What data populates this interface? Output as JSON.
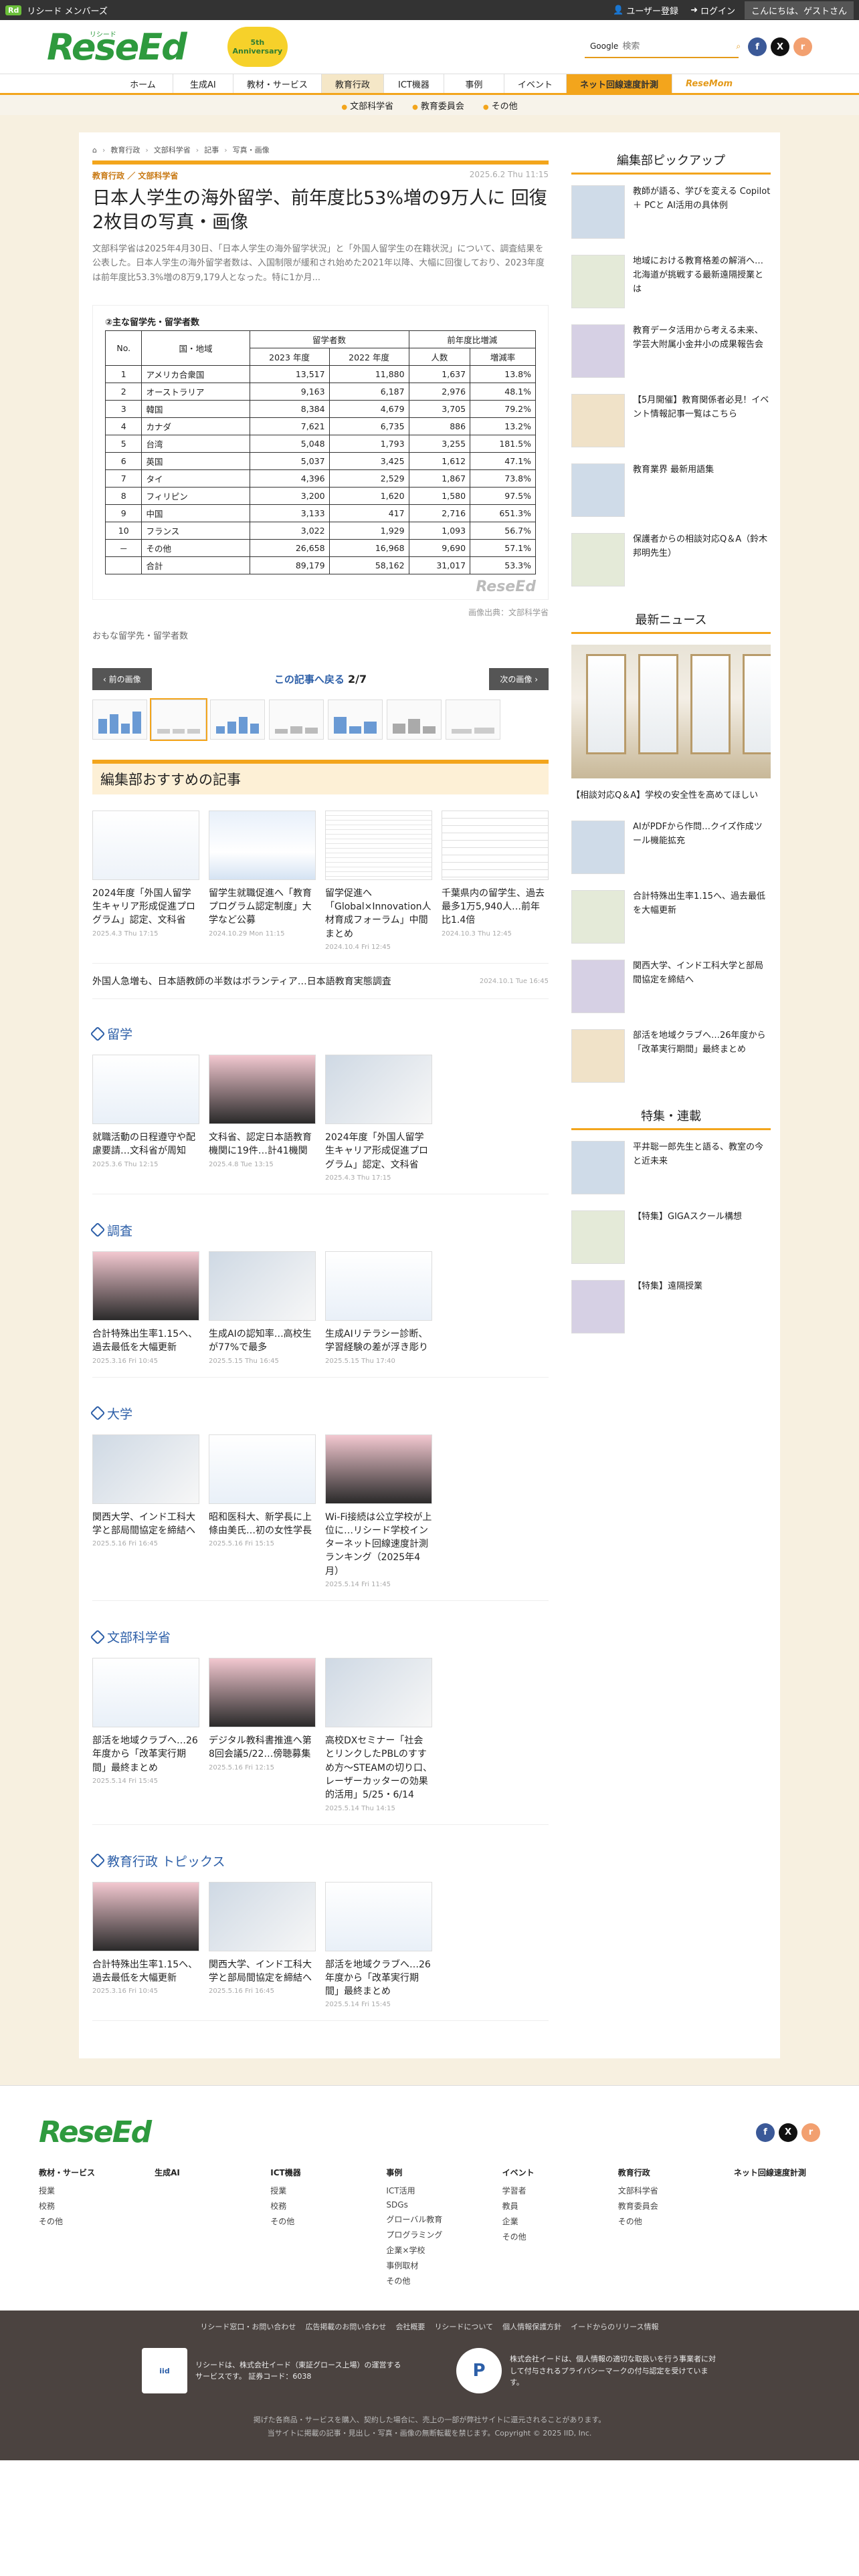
{
  "topbar": {
    "brand": "Rd",
    "brand_text": "リシード メンバーズ",
    "user_reg": "ユーザー登録",
    "login": "ログイン",
    "greeting": "こんにちは、ゲストさん"
  },
  "header": {
    "logo": "ReseEd",
    "logo_kana": "リシード",
    "badge": "5th Anniversary",
    "search_label": "Google",
    "search_placeholder": "検索"
  },
  "social": {
    "facebook": "f",
    "x": "X",
    "rss": "r"
  },
  "nav": [
    "ホーム",
    "生成AI",
    "教材・サービス",
    "教育行政",
    "ICT機器",
    "事例",
    "イベント",
    "ネット回線速度計測",
    "ReseMom"
  ],
  "subnav": [
    "文部科学省",
    "教育委員会",
    "その他"
  ],
  "breadcrumb": [
    "教育行政",
    "文部科学省",
    "記事",
    "写真・画像"
  ],
  "article": {
    "cat1": "教育行政",
    "cat_sep": "／",
    "cat2": "文部科学省",
    "date": "2025.6.2 Thu 11:15",
    "title": "日本人学生の海外留学、前年度比53%増の9万人に 回復 2枚目の写真・画像",
    "lead": "文部科学省は2025年4月30日、「日本人学生の海外留学状況」と「外国人留学生の在籍状況」について、調査結果を公表した。日本人学生の海外留学者数は、入国制限が緩和され始めた2021年以降、大幅に回復しており、2023年度は前年度比53.3%増の8万9,179人となった。特に1か月..."
  },
  "figure": {
    "title": "②主な留学先・留学者数",
    "headers": {
      "no": "No.",
      "country": "国・地域",
      "count": "留学者数",
      "y2023": "2023 年度",
      "y2022": "2022 年度",
      "yoy": "前年度比増減",
      "num": "人数",
      "rate": "増減率"
    },
    "rows": [
      [
        "1",
        "アメリカ合衆国",
        "13,517",
        "11,880",
        "1,637",
        "13.8%"
      ],
      [
        "2",
        "オーストラリア",
        "9,163",
        "6,187",
        "2,976",
        "48.1%"
      ],
      [
        "3",
        "韓国",
        "8,384",
        "4,679",
        "3,705",
        "79.2%"
      ],
      [
        "4",
        "カナダ",
        "7,621",
        "6,735",
        "886",
        "13.2%"
      ],
      [
        "5",
        "台湾",
        "5,048",
        "1,793",
        "3,255",
        "181.5%"
      ],
      [
        "6",
        "英国",
        "5,037",
        "3,425",
        "1,612",
        "47.1%"
      ],
      [
        "7",
        "タイ",
        "4,396",
        "2,529",
        "1,867",
        "73.8%"
      ],
      [
        "8",
        "フィリピン",
        "3,200",
        "1,620",
        "1,580",
        "97.5%"
      ],
      [
        "9",
        "中国",
        "3,133",
        "417",
        "2,716",
        "651.3%"
      ],
      [
        "10",
        "フランス",
        "3,022",
        "1,929",
        "1,093",
        "56.7%"
      ],
      [
        "－",
        "その他",
        "26,658",
        "16,968",
        "9,690",
        "57.1%"
      ],
      [
        "",
        "合計",
        "89,179",
        "58,162",
        "31,017",
        "53.3%"
      ]
    ],
    "watermark": "ReseEd",
    "credit": "画像出典：文部科学省",
    "caption": "おもな留学先・留学者数"
  },
  "pager": {
    "prev": "前の画像",
    "back": "この記事へ戻る",
    "count": "2/7",
    "next": "次の画像"
  },
  "recommend": {
    "title": "編集部おすすめの記事",
    "cards": [
      {
        "t": "2024年度「外国人留学生キャリア形成促進プログラム」認定、文科省",
        "d": "2025.4.3 Thu 17:15"
      },
      {
        "t": "留学生就職促進へ「教育プログラム認定制度」大学など公募",
        "d": "2024.10.29 Mon 11:15"
      },
      {
        "t": "留学促進へ「Global×Innovation人材育成フォーラム」中間まとめ",
        "d": "2024.10.4 Fri 12:45"
      },
      {
        "t": "千葉県内の留学生、過去最多1万5,940人…前年比1.4倍",
        "d": "2024.10.3 Thu 12:45"
      }
    ],
    "wide": {
      "t": "外国人急増も、日本語教師の半数はボランティア…日本語教育実態調査",
      "d": "2024.10.1 Tue 16:45"
    }
  },
  "sections": [
    {
      "title": "留学",
      "cards": [
        {
          "t": "就職活動の日程遵守や配慮要請…文科省が周知",
          "d": "2025.3.6 Thu 12:15"
        },
        {
          "t": "文科省、認定日本語教育機関に19件…計41機関",
          "d": "2025.4.8 Tue 13:15"
        },
        {
          "t": "2024年度「外国人留学生キャリア形成促進プログラム」認定、文科省",
          "d": "2025.4.3 Thu 17:15"
        }
      ]
    },
    {
      "title": "調査",
      "cards": [
        {
          "t": "合計特殊出生率1.15へ、過去最低を大幅更新",
          "d": "2025.3.16 Fri 10:45"
        },
        {
          "t": "生成AIの認知率…高校生が77%で最多",
          "d": "2025.5.15 Thu 16:45"
        },
        {
          "t": "生成AIリテラシー診断、学習経験の差が浮き彫り",
          "d": "2025.5.15 Thu 17:40"
        }
      ]
    },
    {
      "title": "大学",
      "cards": [
        {
          "t": "関西大学、インド工科大学と部局間協定を締結へ",
          "d": "2025.5.16 Fri 16:45"
        },
        {
          "t": "昭和医科大、新学長に上條由美氏…初の女性学長",
          "d": "2025.5.16 Fri 15:15"
        },
        {
          "t": "Wi-Fi接続は公立学校が上位に…リシード学校インターネット回線速度計測ランキング（2025年4月）",
          "d": "2025.5.14 Fri 11:45"
        }
      ]
    },
    {
      "title": "文部科学省",
      "cards": [
        {
          "t": "部活を地域クラブへ…26年度から「改革実行期間」最終まとめ",
          "d": "2025.5.14 Fri 15:45"
        },
        {
          "t": "デジタル教科書推進へ第8回会議5/22…傍聴募集",
          "d": "2025.5.16 Fri 12:15"
        },
        {
          "t": "高校DXセミナー「社会とリンクしたPBLのすすめ方〜STEAMの切り口、レーザーカッターの効果的活用」5/25・6/14",
          "d": "2025.5.14 Thu 14:15"
        }
      ]
    },
    {
      "title": "教育行政 トピックス",
      "cards": [
        {
          "t": "合計特殊出生率1.15へ、過去最低を大幅更新",
          "d": "2025.3.16 Fri 10:45"
        },
        {
          "t": "関西大学、インド工科大学と部局間協定を締結へ",
          "d": "2025.5.16 Fri 16:45"
        },
        {
          "t": "部活を地域クラブへ…26年度から「改革実行期間」最終まとめ",
          "d": "2025.5.14 Fri 15:45"
        }
      ]
    }
  ],
  "sidebar": {
    "pickup_title": "編集部ピックアップ",
    "pickup": [
      "教師が語る、学びを変える Copilot＋ PCと AI活用の具体例",
      "地域における教育格差の解消へ…北海道が挑戦する最新遠隔授業とは",
      "教育データ活用から考える未来、学芸大附属小金井小の成果報告会",
      "【5月開催】教育関係者必見！イベント情報記事一覧はこちら",
      "教育業界 最新用語集",
      "保護者からの相談対応Q＆A（鈴木邦明先生）"
    ],
    "news_title": "最新ニュース",
    "news_big": "【相談対応Q＆A】学校の安全性を高めてほしい",
    "news": [
      "AIがPDFから作問…クイズ作成ツール機能拡充",
      "合計特殊出生率1.15へ、過去最低を大幅更新",
      "関西大学、インド工科大学と部局間協定を締結へ",
      "部活を地域クラブへ…26年度から「改革実行期間」最終まとめ"
    ],
    "feature_title": "特集・連載",
    "features": [
      "平井聡一郎先生と語る、教室の今と近未来",
      "【特集】GIGAスクール構想",
      "【特集】遠隔授業"
    ]
  },
  "footer": {
    "logo": "ReseEd",
    "cols": [
      {
        "h": "教材・サービス",
        "l": [
          "授業",
          "校務",
          "その他"
        ]
      },
      {
        "h": "生成AI",
        "l": []
      },
      {
        "h": "ICT機器",
        "l": [
          "授業",
          "校務",
          "その他"
        ]
      },
      {
        "h": "事例",
        "l": [
          "ICT活用",
          "SDGs",
          "グローバル教育",
          "プログラミング",
          "企業×学校",
          "事例取材",
          "その他"
        ]
      },
      {
        "h": "イベント",
        "l": [
          "学習者",
          "教員",
          "企業",
          "その他"
        ]
      },
      {
        "h": "教育行政",
        "l": [
          "文部科学省",
          "教育委員会",
          "その他"
        ]
      },
      {
        "h": "ネット回線速度計測",
        "l": []
      }
    ],
    "links": [
      "リシード窓口・お問い合わせ",
      "広告掲載のお問い合わせ",
      "会社概要",
      "リシードについて",
      "個人情報保護方針",
      "イードからのリリース情報"
    ],
    "badge1": "リシードは、株式会社イード（東証グロース上場）の運営するサービスです。 証券コード：6038",
    "badge2": "株式会社イードは、個人情報の適切な取扱いを行う事業者に対して付与されるプライバシーマークの付与認定を受けています。",
    "logo1": "iid",
    "logo2": "P",
    "copy1": "掲げた各商品・サービスを購入、契約した場合に、売上の一部が弊社サイトに還元されることがあります。",
    "copy2": "当サイトに掲載の記事・見出し・写真・画像の無断転載を禁じます。Copyright © 2025 IID, Inc."
  }
}
